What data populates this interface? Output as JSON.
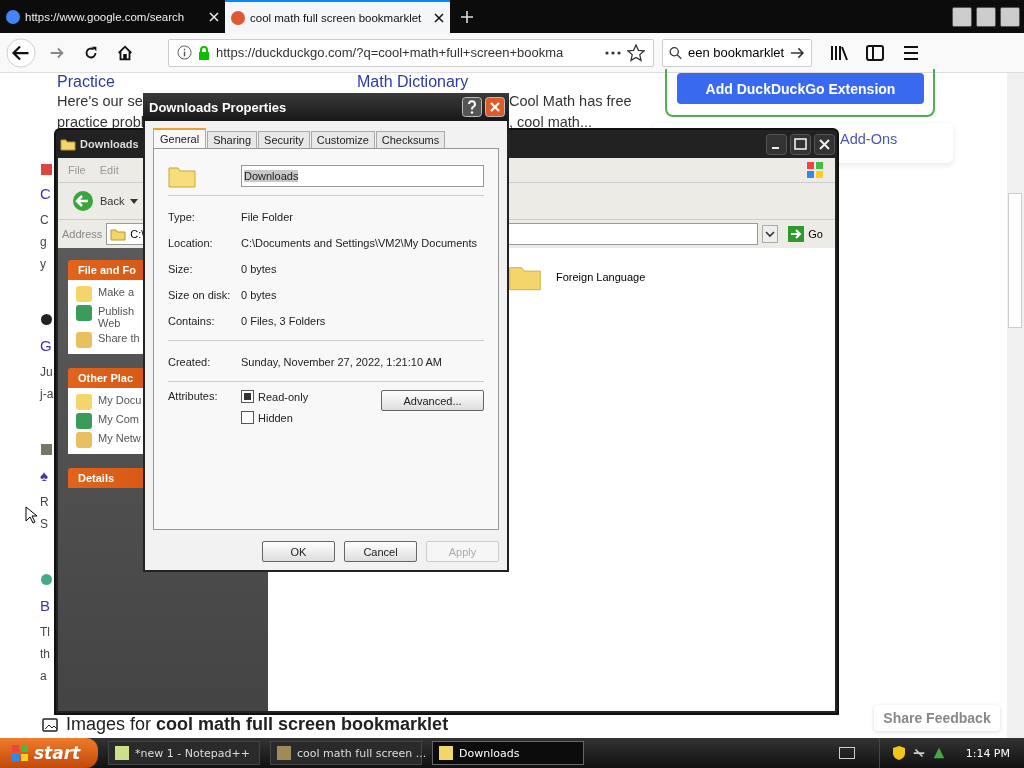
{
  "browser": {
    "tabs": [
      {
        "label": "https://www.google.com/search",
        "selected": false
      },
      {
        "label": "cool math full screen bookmarklet",
        "selected": true
      }
    ],
    "url": "https://duckduckgo.com/?q=cool+math+full+screen+bookma",
    "search": "een bookmarklet"
  },
  "page": {
    "top_links": [
      {
        "heading": "Practice",
        "lines": [
          "Here's our se",
          "practice probl"
        ]
      },
      {
        "heading": "Math Dictionary",
        "lines": [
          "Cool Math has free",
          ", cool math..."
        ]
      }
    ],
    "left_fragments": [
      {
        "text": "C",
        "kind": "title"
      },
      {
        "text": "C",
        "kind": "text"
      },
      {
        "text": "g",
        "kind": "text"
      },
      {
        "text": "y",
        "kind": "text"
      },
      {
        "text": "G",
        "kind": "title"
      },
      {
        "text": "Ju",
        "kind": "text"
      },
      {
        "text": "j-a",
        "kind": "text"
      },
      {
        "text": "♠",
        "kind": "title"
      },
      {
        "text": "R",
        "kind": "text"
      },
      {
        "text": "S",
        "kind": "text"
      },
      {
        "text": "B",
        "kind": "title"
      },
      {
        "text": "Tl",
        "kind": "text"
      },
      {
        "text": "th",
        "kind": "text"
      },
      {
        "text": "a",
        "kind": "text"
      }
    ],
    "extension_button": "Add DuckDuckGo Extension",
    "addons_link": "Add-Ons",
    "images_heading": "Images for **cool math full screen bookmarklet**",
    "feedback_button": "Share Feedback"
  },
  "explorer": {
    "title": "Downloads",
    "menu": [
      "File",
      "Edit"
    ],
    "back": "Back",
    "address_label": "Address",
    "address": "C:\\",
    "go": "Go",
    "panels": [
      {
        "title": "File and Fo",
        "items": [
          "Make a",
          "Publish",
          "Share th"
        ],
        "extra": "Web"
      },
      {
        "title": "Other Plac",
        "items": [
          "My Docu",
          "My Com",
          "My Netw"
        ]
      },
      {
        "title": "Details"
      }
    ],
    "files": [
      {
        "name": "Foreign Language"
      }
    ]
  },
  "dialog": {
    "title": "Downloads Properties",
    "tabs": [
      {
        "label": "General",
        "selected": true
      },
      {
        "label": "Sharing",
        "selected": false
      },
      {
        "label": "Security",
        "selected": false
      },
      {
        "label": "Customize",
        "selected": false
      },
      {
        "label": "Checksums",
        "selected": false
      }
    ],
    "name": "Downloads",
    "rows": [
      {
        "label": "Type:",
        "value": "File Folder"
      },
      {
        "label": "Location:",
        "value": "C:\\Documents and Settings\\VM2\\My Documents"
      },
      {
        "label": "Size:",
        "value": "0 bytes"
      },
      {
        "label": "Size on disk:",
        "value": "0 bytes"
      },
      {
        "label": "Contains:",
        "value": "0 Files, 3 Folders"
      }
    ],
    "created_label": "Created:",
    "created": "Sunday, November 27, 2022, 1:21:10 AM",
    "attributes_label": "Attributes:",
    "attributes": [
      {
        "label": "Read-only",
        "checked": true
      },
      {
        "label": "Hidden",
        "checked": false
      }
    ],
    "advanced": "Advanced...",
    "buttons": [
      {
        "label": "OK",
        "disabled": false
      },
      {
        "label": "Cancel",
        "disabled": false
      },
      {
        "label": "Apply",
        "disabled": true
      }
    ]
  },
  "taskbar": {
    "start": "start",
    "tasks": [
      {
        "label": "*new 1 - Notepad++",
        "selected": false
      },
      {
        "label": "cool math full screen ...",
        "selected": false
      },
      {
        "label": "Downloads",
        "selected": true
      }
    ],
    "clock": "1:14 PM"
  }
}
